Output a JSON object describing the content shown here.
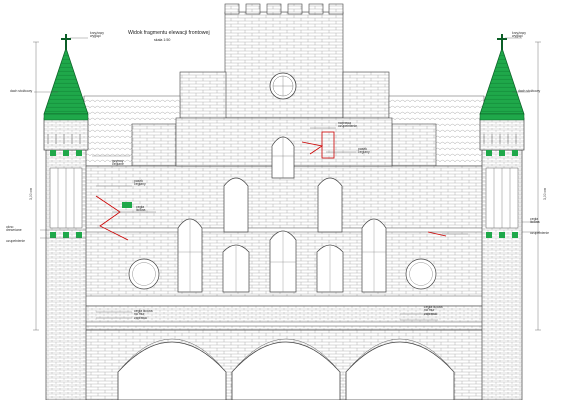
{
  "title": "Widok fragmentu elewacji frontowej",
  "scale": "skala 1:50",
  "colors": {
    "line": "#444444",
    "roof_green": "#1fa84a",
    "accent_red": "#cc0000"
  },
  "labels": {
    "cross_left": "krzyżowy\nwygląd",
    "roof_left": "dach stożkowy",
    "cornice_left": "gzymsy\nceglane",
    "band_left": "pasek\nceglany",
    "brick_left": "cegła\nlicowa",
    "window_left": "okno\ndrewniane",
    "dim_left": "3,00 cm",
    "cross_right": "krzyżowy\nwygląd",
    "roof_right": "dach stożkowy",
    "repair_right": "naprawa\nuzupełnienie",
    "band_right": "pasek\nceglany",
    "brick_right": "cegła\nlicowa",
    "dim_right": "3,00 cm",
    "bottom_left": "cegła licowa\nna mur\nzaprawa",
    "bottom_right": "cegła licowa\nna mur\nzaprawa",
    "mid_left": "uzupełnienie",
    "mid_right": "uzupełnienie"
  }
}
